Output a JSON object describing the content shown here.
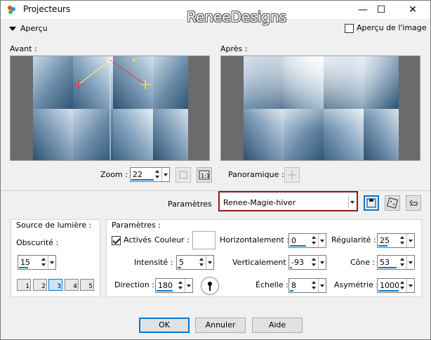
{
  "window": {
    "title": "Projecteurs",
    "watermark": "ReneeDesigns",
    "minimize": "—",
    "maximize": "☐",
    "close": "✕"
  },
  "apercu": {
    "toggle_label": "Aperçu",
    "image_preview_label": "Aperçu de l'image"
  },
  "preview": {
    "before_label": "Avant :",
    "after_label": "Après :"
  },
  "zoom": {
    "label": "Zoom :",
    "value": "22"
  },
  "panoramique": {
    "label": "Panoramique :"
  },
  "parametres_preset": {
    "label": "Paramètres",
    "value": "Renee-Magie-hiver"
  },
  "light_source": {
    "title": "Source de lumière :",
    "obscurite_label": "Obscurité :",
    "obscurite_value": "15",
    "lights": [
      "1",
      "2",
      "3",
      "4",
      "5"
    ]
  },
  "params": {
    "title": "Paramètres :",
    "actives_label": "Activés",
    "couleur_label": "Couleur :",
    "intensite_label": "Intensité :",
    "intensite_value": "5",
    "direction_label": "Direction :",
    "direction_value": "180",
    "horizontal_label": "Horizontalement :",
    "horizontal_value": "0",
    "vertical_label": "Verticalement :",
    "vertical_value": "-93",
    "echelle_label": "Échelle :",
    "echelle_value": "8",
    "regularite_label": "Régularité :",
    "regularite_value": "25",
    "cone_label": "Cône :",
    "cone_value": "53",
    "asymetrie_label": "Asymétrie :",
    "asymetrie_value": "1000"
  },
  "buttons": {
    "ok": "OK",
    "annuler": "Annuler",
    "aide": "Aide"
  },
  "colors": {
    "accent": "#0078d7",
    "preset_border": "#8b1a1a",
    "preview_bg": "#6b6b6b"
  }
}
